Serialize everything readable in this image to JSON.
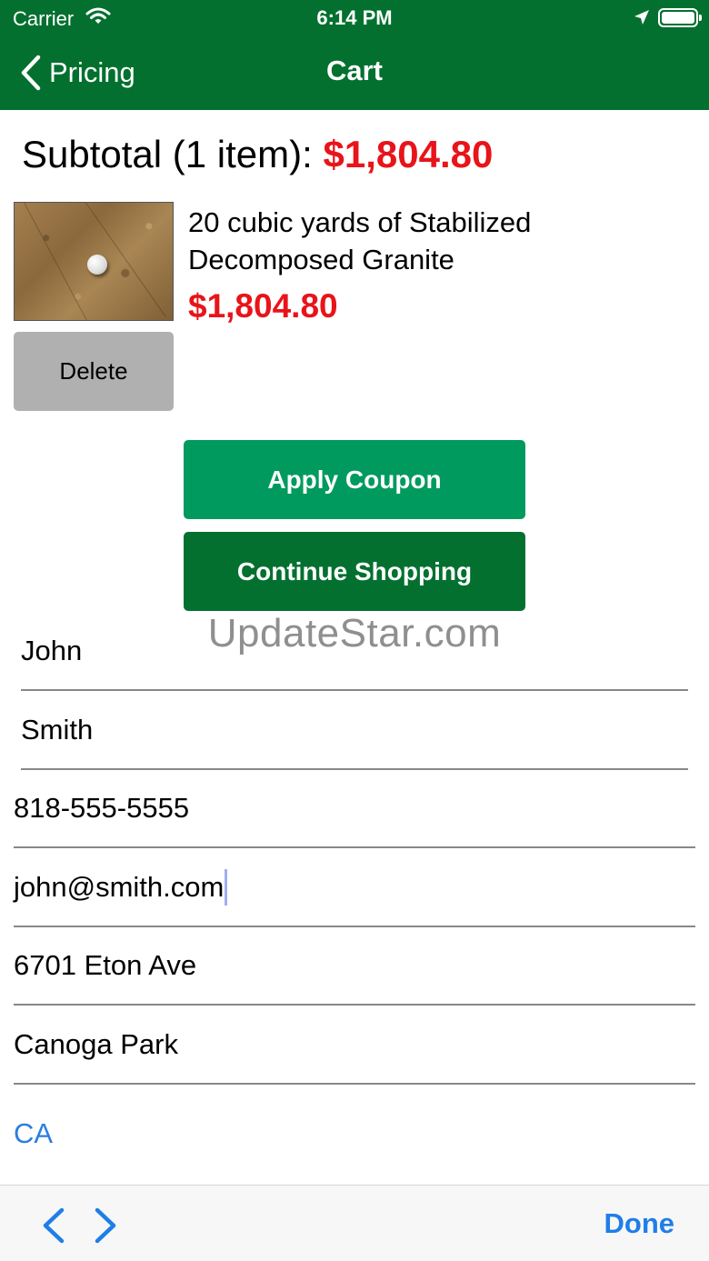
{
  "status_bar": {
    "carrier": "Carrier",
    "time": "6:14 PM"
  },
  "nav": {
    "back_label": "Pricing",
    "title": "Cart"
  },
  "cart": {
    "subtotal_label": "Subtotal (1 item):",
    "subtotal_amount": "$1,804.80",
    "item": {
      "name": "20 cubic yards of Stabilized Decomposed Granite",
      "price": "$1,804.80",
      "delete_label": "Delete"
    }
  },
  "actions": {
    "apply_coupon": "Apply Coupon",
    "continue_shopping": "Continue Shopping"
  },
  "watermark": "UpdateStar.com",
  "form": {
    "first_name": "John",
    "last_name": "Smith",
    "phone": "818-555-5555",
    "email": "john@smith.com",
    "address": "6701 Eton Ave",
    "city": "Canoga Park",
    "state": "CA"
  },
  "keyboard_toolbar": {
    "done_label": "Done"
  },
  "colors": {
    "brand_green": "#03702f",
    "coupon_green": "#009a5e",
    "price_red": "#e8141a",
    "link_blue": "#1f7ee8"
  }
}
